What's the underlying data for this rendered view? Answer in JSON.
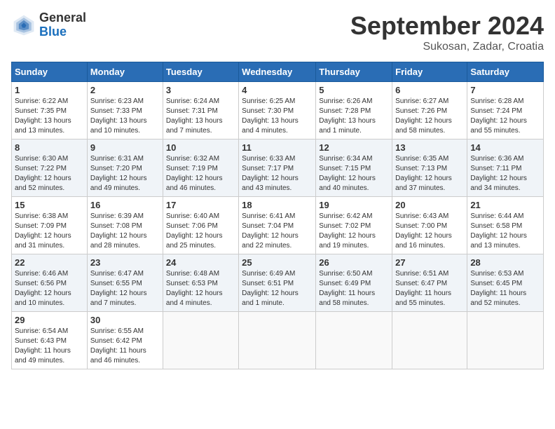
{
  "header": {
    "logo_general": "General",
    "logo_blue": "Blue",
    "month_year": "September 2024",
    "location": "Sukosan, Zadar, Croatia"
  },
  "calendar": {
    "days_of_week": [
      "Sunday",
      "Monday",
      "Tuesday",
      "Wednesday",
      "Thursday",
      "Friday",
      "Saturday"
    ],
    "weeks": [
      [
        {
          "day": "1",
          "info": "Sunrise: 6:22 AM\nSunset: 7:35 PM\nDaylight: 13 hours\nand 13 minutes."
        },
        {
          "day": "2",
          "info": "Sunrise: 6:23 AM\nSunset: 7:33 PM\nDaylight: 13 hours\nand 10 minutes."
        },
        {
          "day": "3",
          "info": "Sunrise: 6:24 AM\nSunset: 7:31 PM\nDaylight: 13 hours\nand 7 minutes."
        },
        {
          "day": "4",
          "info": "Sunrise: 6:25 AM\nSunset: 7:30 PM\nDaylight: 13 hours\nand 4 minutes."
        },
        {
          "day": "5",
          "info": "Sunrise: 6:26 AM\nSunset: 7:28 PM\nDaylight: 13 hours\nand 1 minute."
        },
        {
          "day": "6",
          "info": "Sunrise: 6:27 AM\nSunset: 7:26 PM\nDaylight: 12 hours\nand 58 minutes."
        },
        {
          "day": "7",
          "info": "Sunrise: 6:28 AM\nSunset: 7:24 PM\nDaylight: 12 hours\nand 55 minutes."
        }
      ],
      [
        {
          "day": "8",
          "info": "Sunrise: 6:30 AM\nSunset: 7:22 PM\nDaylight: 12 hours\nand 52 minutes."
        },
        {
          "day": "9",
          "info": "Sunrise: 6:31 AM\nSunset: 7:20 PM\nDaylight: 12 hours\nand 49 minutes."
        },
        {
          "day": "10",
          "info": "Sunrise: 6:32 AM\nSunset: 7:19 PM\nDaylight: 12 hours\nand 46 minutes."
        },
        {
          "day": "11",
          "info": "Sunrise: 6:33 AM\nSunset: 7:17 PM\nDaylight: 12 hours\nand 43 minutes."
        },
        {
          "day": "12",
          "info": "Sunrise: 6:34 AM\nSunset: 7:15 PM\nDaylight: 12 hours\nand 40 minutes."
        },
        {
          "day": "13",
          "info": "Sunrise: 6:35 AM\nSunset: 7:13 PM\nDaylight: 12 hours\nand 37 minutes."
        },
        {
          "day": "14",
          "info": "Sunrise: 6:36 AM\nSunset: 7:11 PM\nDaylight: 12 hours\nand 34 minutes."
        }
      ],
      [
        {
          "day": "15",
          "info": "Sunrise: 6:38 AM\nSunset: 7:09 PM\nDaylight: 12 hours\nand 31 minutes."
        },
        {
          "day": "16",
          "info": "Sunrise: 6:39 AM\nSunset: 7:08 PM\nDaylight: 12 hours\nand 28 minutes."
        },
        {
          "day": "17",
          "info": "Sunrise: 6:40 AM\nSunset: 7:06 PM\nDaylight: 12 hours\nand 25 minutes."
        },
        {
          "day": "18",
          "info": "Sunrise: 6:41 AM\nSunset: 7:04 PM\nDaylight: 12 hours\nand 22 minutes."
        },
        {
          "day": "19",
          "info": "Sunrise: 6:42 AM\nSunset: 7:02 PM\nDaylight: 12 hours\nand 19 minutes."
        },
        {
          "day": "20",
          "info": "Sunrise: 6:43 AM\nSunset: 7:00 PM\nDaylight: 12 hours\nand 16 minutes."
        },
        {
          "day": "21",
          "info": "Sunrise: 6:44 AM\nSunset: 6:58 PM\nDaylight: 12 hours\nand 13 minutes."
        }
      ],
      [
        {
          "day": "22",
          "info": "Sunrise: 6:46 AM\nSunset: 6:56 PM\nDaylight: 12 hours\nand 10 minutes."
        },
        {
          "day": "23",
          "info": "Sunrise: 6:47 AM\nSunset: 6:55 PM\nDaylight: 12 hours\nand 7 minutes."
        },
        {
          "day": "24",
          "info": "Sunrise: 6:48 AM\nSunset: 6:53 PM\nDaylight: 12 hours\nand 4 minutes."
        },
        {
          "day": "25",
          "info": "Sunrise: 6:49 AM\nSunset: 6:51 PM\nDaylight: 12 hours\nand 1 minute."
        },
        {
          "day": "26",
          "info": "Sunrise: 6:50 AM\nSunset: 6:49 PM\nDaylight: 11 hours\nand 58 minutes."
        },
        {
          "day": "27",
          "info": "Sunrise: 6:51 AM\nSunset: 6:47 PM\nDaylight: 11 hours\nand 55 minutes."
        },
        {
          "day": "28",
          "info": "Sunrise: 6:53 AM\nSunset: 6:45 PM\nDaylight: 11 hours\nand 52 minutes."
        }
      ],
      [
        {
          "day": "29",
          "info": "Sunrise: 6:54 AM\nSunset: 6:43 PM\nDaylight: 11 hours\nand 49 minutes."
        },
        {
          "day": "30",
          "info": "Sunrise: 6:55 AM\nSunset: 6:42 PM\nDaylight: 11 hours\nand 46 minutes."
        },
        {
          "day": "",
          "info": ""
        },
        {
          "day": "",
          "info": ""
        },
        {
          "day": "",
          "info": ""
        },
        {
          "day": "",
          "info": ""
        },
        {
          "day": "",
          "info": ""
        }
      ]
    ]
  }
}
